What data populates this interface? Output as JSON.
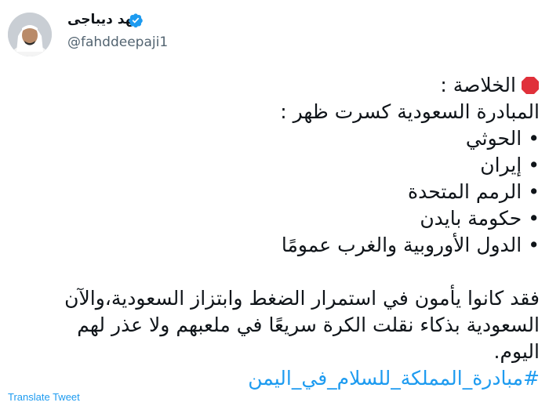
{
  "author": {
    "name": "فهد ديباجى",
    "handle": "@fahddeepaji1"
  },
  "tweet": {
    "summary_label": "الخلاصة :",
    "intro": "المبادرة السعودية كسرت ظهر :",
    "bullets": [
      "الحوثي",
      "إيران",
      "الرمم المتحدة",
      "حكومة بايدن",
      "الدول الأوروبية والغرب عمومًا"
    ],
    "paragraph_lines": [
      "فقد كانوا يأمون في استمرار الضغط وابتزاز السعودية،والآن",
      "السعودية بذكاء نقلت الكرة سريعًا في ملعبهم ولا عذر لهم",
      "اليوم."
    ],
    "hashtag": "#مبادرة_المملكة_للسلام_في_اليمن"
  },
  "translate_label": "Translate Tweet",
  "colors": {
    "link": "#1d9bf0",
    "text": "#0f1419",
    "secondary": "#536471",
    "verified": "#1d9bf0",
    "stop": "#e0303a"
  }
}
